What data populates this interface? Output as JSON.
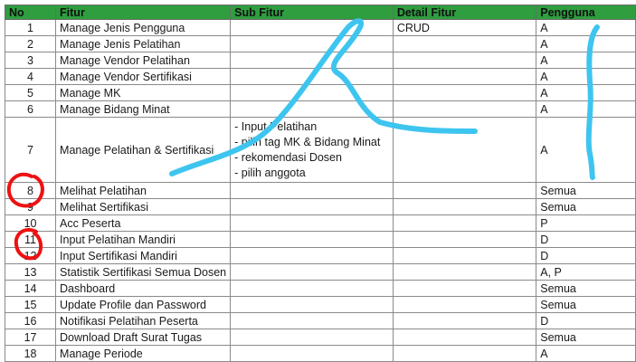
{
  "columns": {
    "no": "No",
    "fitur": "Fitur",
    "sub_fitur": "Sub Fitur",
    "detail_fitur": "Detail Fitur",
    "pengguna": "Pengguna"
  },
  "rows": [
    {
      "no": "1",
      "fitur": "Manage Jenis Pengguna",
      "sub": [],
      "detail": "CRUD",
      "pengguna": "A"
    },
    {
      "no": "2",
      "fitur": "Manage Jenis Pelatihan",
      "sub": [],
      "detail": "",
      "pengguna": "A"
    },
    {
      "no": "3",
      "fitur": "Manage Vendor Pelatihan",
      "sub": [],
      "detail": "",
      "pengguna": "A"
    },
    {
      "no": "4",
      "fitur": "Manage Vendor Sertifikasi",
      "sub": [],
      "detail": "",
      "pengguna": "A"
    },
    {
      "no": "5",
      "fitur": "Manage MK",
      "sub": [],
      "detail": "",
      "pengguna": "A"
    },
    {
      "no": "6",
      "fitur": "Manage Bidang Minat",
      "sub": [],
      "detail": "",
      "pengguna": "A"
    },
    {
      "no": "7",
      "fitur": "Manage Pelatihan & Sertifikasi",
      "sub": [
        "- Input Pelatihan",
        "- pilih tag MK & Bidang Minat",
        "- rekomendasi Dosen",
        "- pilih anggota"
      ],
      "detail": "",
      "pengguna": "A"
    },
    {
      "no": "8",
      "fitur": "Melihat Pelatihan",
      "sub": [],
      "detail": "",
      "pengguna": "Semua"
    },
    {
      "no": "9",
      "fitur": "Melihat Sertifikasi",
      "sub": [],
      "detail": "",
      "pengguna": "Semua"
    },
    {
      "no": "10",
      "fitur": "Acc Peserta",
      "sub": [],
      "detail": "",
      "pengguna": "P"
    },
    {
      "no": "11",
      "fitur": "Input Pelatihan Mandiri",
      "sub": [],
      "detail": "",
      "pengguna": "D"
    },
    {
      "no": "12",
      "fitur": "Input Sertifikasi Mandiri",
      "sub": [],
      "detail": "",
      "pengguna": "D"
    },
    {
      "no": "13",
      "fitur": "Statistik Sertifikasi Semua Dosen",
      "sub": [],
      "detail": "",
      "pengguna": "A, P"
    },
    {
      "no": "14",
      "fitur": "Dashboard",
      "sub": [],
      "detail": "",
      "pengguna": "Semua"
    },
    {
      "no": "15",
      "fitur": "Update Profile dan Password",
      "sub": [],
      "detail": "",
      "pengguna": "Semua"
    },
    {
      "no": "16",
      "fitur": "Notifikasi Pelatihan Peserta",
      "sub": [],
      "detail": "",
      "pengguna": "D"
    },
    {
      "no": "17",
      "fitur": "Download Draft Surat Tugas",
      "sub": [],
      "detail": "",
      "pengguna": "Semua"
    },
    {
      "no": "18",
      "fitur": "Manage Periode",
      "sub": [],
      "detail": "",
      "pengguna": "A"
    }
  ],
  "colors": {
    "header_bg": "#2e9e3f",
    "scribble_blue": "#3ec5ef",
    "circle_red": "#ee1111"
  }
}
